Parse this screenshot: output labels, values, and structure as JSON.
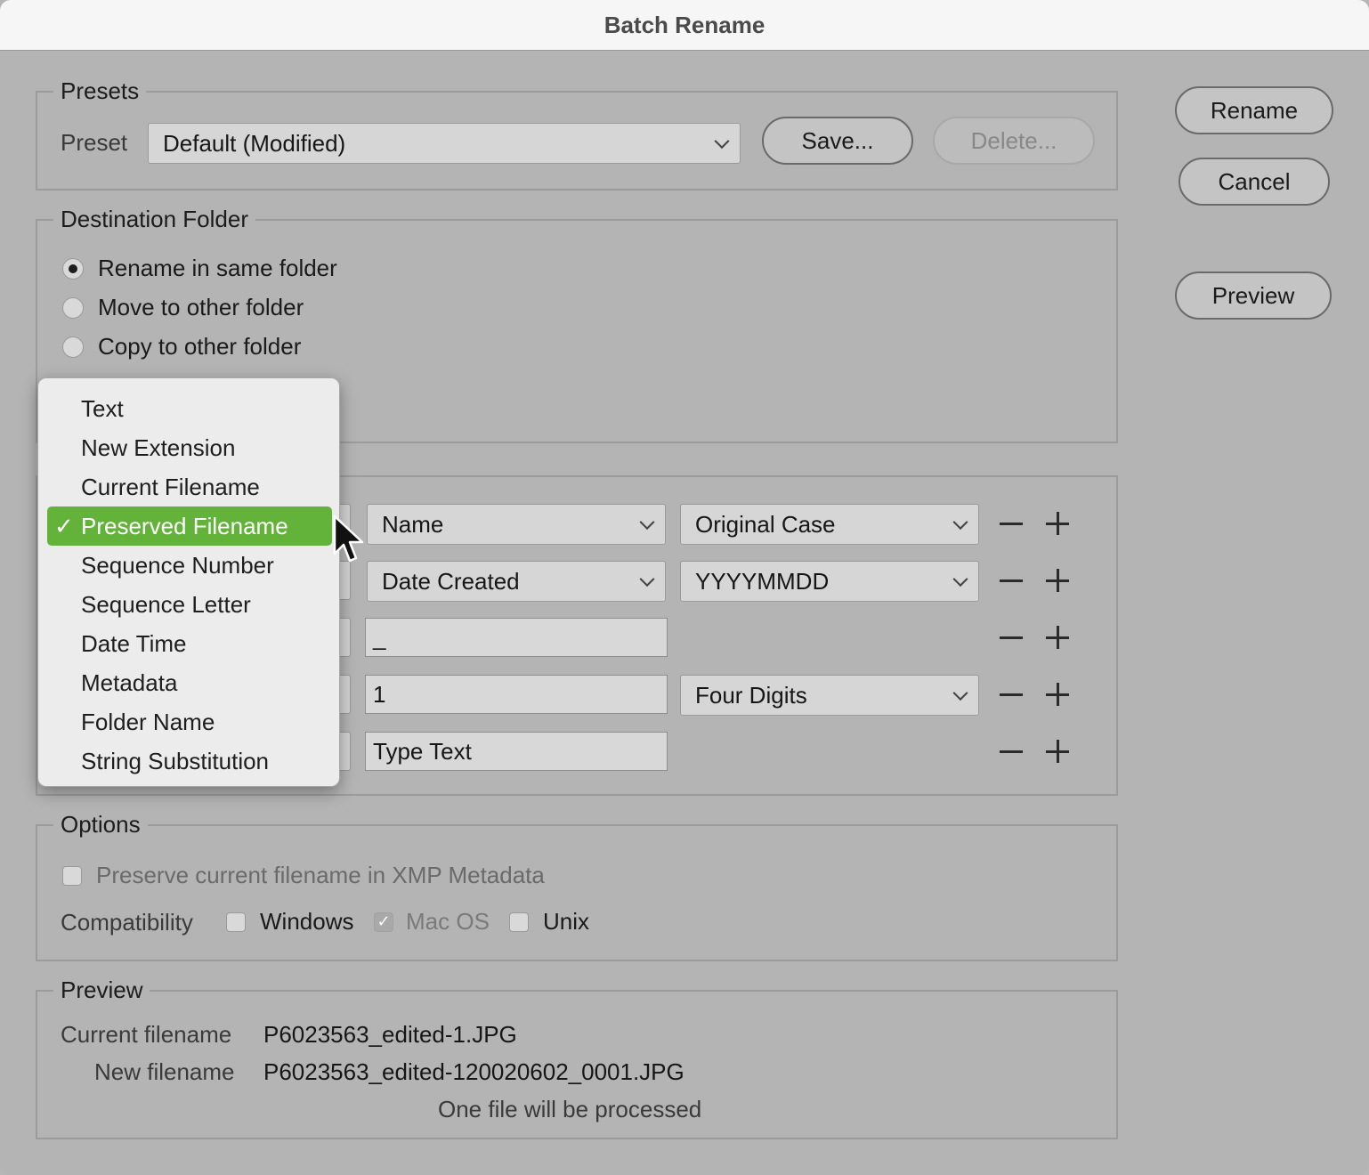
{
  "window": {
    "title": "Batch Rename"
  },
  "presets": {
    "legend": "Presets",
    "label": "Preset",
    "selected": "Default (Modified)",
    "save_label": "Save...",
    "delete_label": "Delete..."
  },
  "actions": {
    "rename_label": "Rename",
    "cancel_label": "Cancel",
    "preview_label": "Preview"
  },
  "destination": {
    "legend": "Destination Folder",
    "options": [
      "Rename in same folder",
      "Move to other folder",
      "Copy to other folder"
    ],
    "selected_index": 0
  },
  "rename_rows": [
    {
      "field1": "Name",
      "field2": "Original Case"
    },
    {
      "field1": "Date Created",
      "field2": "YYYYMMDD"
    },
    {
      "field1": "_"
    },
    {
      "field1": "1",
      "field2": "Four Digits"
    },
    {
      "field1": "Type Text"
    }
  ],
  "element_menu": {
    "items": [
      "Text",
      "New Extension",
      "Current Filename",
      "Preserved Filename",
      "Sequence Number",
      "Sequence Letter",
      "Date Time",
      "Metadata",
      "Folder Name",
      "String Substitution"
    ],
    "selected_index": 3,
    "check_glyph": "✓",
    "selected_color": "#63b239"
  },
  "options": {
    "legend": "Options",
    "preserve_label": "Preserve current filename in XMP Metadata",
    "compat_label": "Compatibility",
    "windows_label": "Windows",
    "macos_label": "Mac OS",
    "unix_label": "Unix",
    "windows_checked": false,
    "macos_checked": true,
    "unix_checked": false
  },
  "preview": {
    "legend": "Preview",
    "current_label": "Current filename",
    "current_value": "P6023563_edited-1.JPG",
    "new_label": "New filename",
    "new_value": "P6023563_edited-120020602_0001.JPG",
    "status": "One file will be processed"
  }
}
